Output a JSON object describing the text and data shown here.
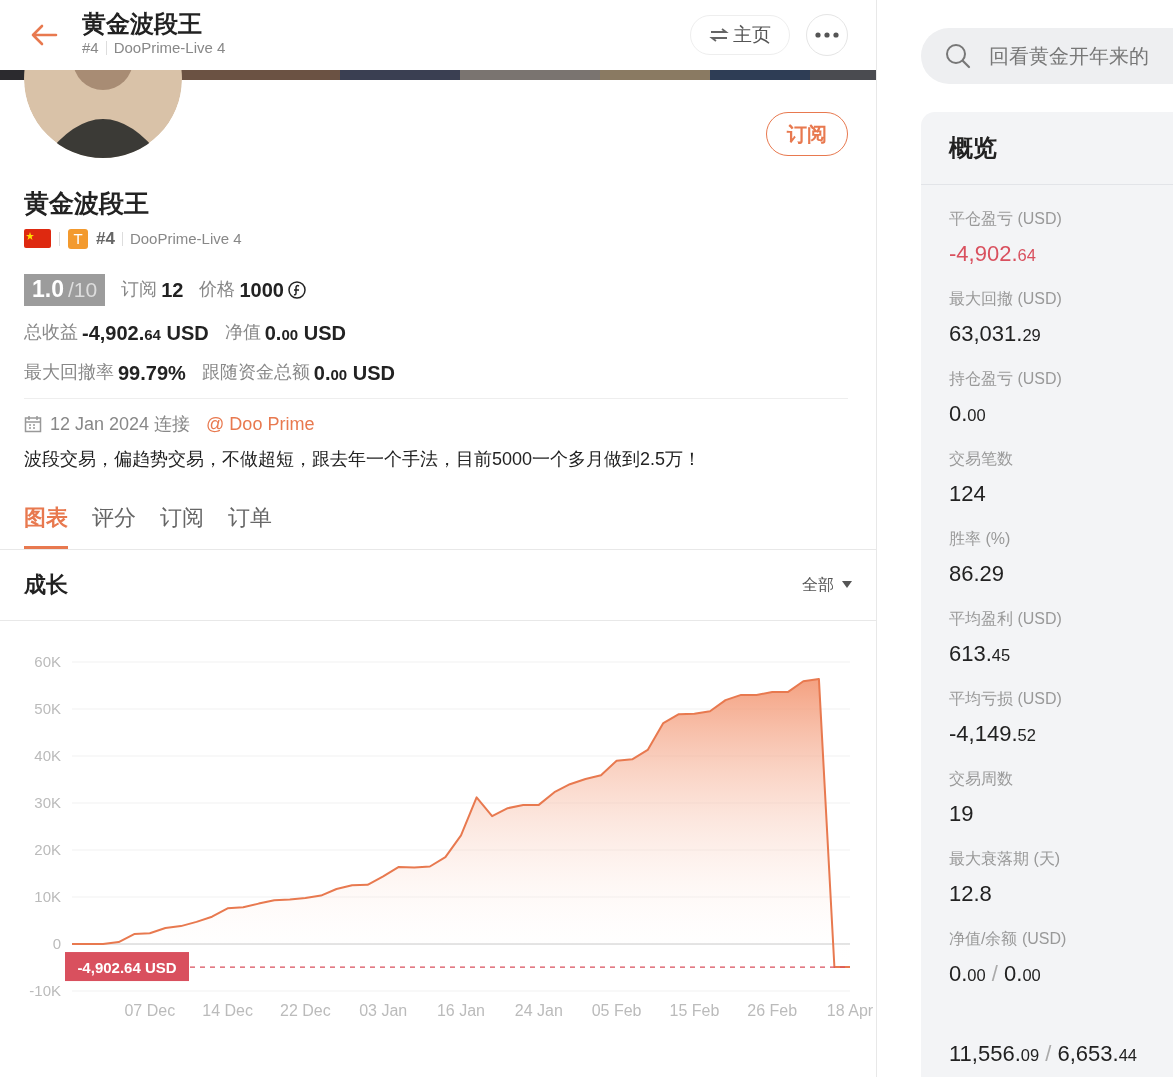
{
  "header": {
    "title": "黄金波段王",
    "rank": "#4",
    "server": "DooPrime-Live 4",
    "home_button": "主页"
  },
  "profile": {
    "subscribe_button": "订阅",
    "name": "黄金波段王",
    "tier_badge": "T",
    "rank": "#4",
    "server": "DooPrime-Live 4",
    "score": "1.0",
    "score_max": "/10",
    "meta": [
      {
        "label": "订阅",
        "value": "12",
        "coin": false
      },
      {
        "label": "价格",
        "value": "1000",
        "coin": true
      }
    ],
    "stat_rows": [
      [
        {
          "label": "总收益",
          "value": "-4,902.64 USD",
          "small_decimals": true
        },
        {
          "label": "净值",
          "value": "0.00 USD",
          "small_decimals": true
        }
      ],
      [
        {
          "label": "最大回撤率",
          "value": "99.79%",
          "small_decimals": false
        },
        {
          "label": "跟随资金总额",
          "value": "0.00 USD",
          "small_decimals": true
        }
      ]
    ],
    "connected": "12 Jan 2024 连接",
    "broker_link": "@ Doo Prime",
    "description": "波段交易，偏趋势交易，不做超短，跟去年一个手法，目前5000一个多月做到2.5万！"
  },
  "tabs": [
    {
      "label": "图表",
      "selected": true
    },
    {
      "label": "评分",
      "selected": false
    },
    {
      "label": "订阅",
      "selected": false
    },
    {
      "label": "订单",
      "selected": false
    }
  ],
  "growth": {
    "title": "成长",
    "range_dropdown": "全部",
    "chart_data": {
      "type": "area",
      "categories": [
        null,
        null,
        null,
        null,
        null,
        "07 Dec",
        null,
        null,
        null,
        null,
        "14 Dec",
        null,
        null,
        null,
        null,
        "22 Dec",
        null,
        null,
        null,
        null,
        "03 Jan",
        null,
        null,
        null,
        null,
        "16 Jan",
        null,
        null,
        null,
        null,
        "24 Jan",
        null,
        null,
        null,
        null,
        "05 Feb",
        null,
        null,
        null,
        null,
        "15 Feb",
        null,
        null,
        null,
        null,
        "26 Feb",
        null,
        null,
        null,
        null,
        "18 Apr"
      ],
      "series": [
        {
          "color": "#e8794f",
          "values": [
            0,
            0,
            0,
            400,
            2100,
            2300,
            3400,
            3800,
            4700,
            5800,
            7600,
            7800,
            8600,
            9300,
            9500,
            9800,
            10300,
            11700,
            12500,
            12600,
            14400,
            16400,
            16300,
            16500,
            18500,
            23100,
            31200,
            27200,
            28900,
            29600,
            29600,
            32300,
            34000,
            35100,
            35900,
            39000,
            39300,
            41300,
            47000,
            48900,
            49000,
            49500,
            51900,
            53000,
            53000,
            53600,
            53600,
            55900,
            56400,
            -4900,
            -4900
          ]
        }
      ],
      "ylim": [
        -10000,
        60000
      ],
      "yticks": [
        {
          "value": 60000,
          "label": "60K"
        },
        {
          "value": 50000,
          "label": "50K"
        },
        {
          "value": 40000,
          "label": "40K"
        },
        {
          "value": 30000,
          "label": "30K"
        },
        {
          "value": 20000,
          "label": "20K"
        },
        {
          "value": 10000,
          "label": "10K"
        },
        {
          "value": 0,
          "label": "0"
        },
        {
          "value": -10000,
          "label": "-10K"
        }
      ],
      "grid": true,
      "ref_lines": [
        {
          "axis": "y",
          "value": -4902.64,
          "label": "-4,902.64 USD",
          "color": "#d9505e"
        }
      ]
    }
  },
  "search": {
    "placeholder": "回看黄金开年来的"
  },
  "overview": {
    "title": "概览",
    "stats": [
      {
        "label": "平仓盈亏 (USD)",
        "value": "-4,902.64",
        "small_decimals": true,
        "color": "#d9505e"
      },
      {
        "label": "最大回撤 (USD)",
        "value": "63,031.29",
        "small_decimals": true
      },
      {
        "label": "持仓盈亏 (USD)",
        "value": "0.00",
        "small_decimals": true
      },
      {
        "label": "交易笔数",
        "value": "124"
      },
      {
        "label": "胜率 (%)",
        "value": "86.29",
        "small_decimals": false
      },
      {
        "label": "平均盈利 (USD)",
        "value": "613.45",
        "small_decimals": true
      },
      {
        "label": "平均亏损 (USD)",
        "value": "-4,149.52",
        "small_decimals": true
      },
      {
        "label": "交易周数",
        "value": "19"
      },
      {
        "label": "最大衰落期 (天)",
        "value": "12.8"
      },
      {
        "label": "净值/余额 (USD)",
        "value": "0.00 / 0.00",
        "small_decimals": true
      },
      {
        "value": "11,556.09 / 6,653.44",
        "small_decimals": true
      }
    ]
  }
}
